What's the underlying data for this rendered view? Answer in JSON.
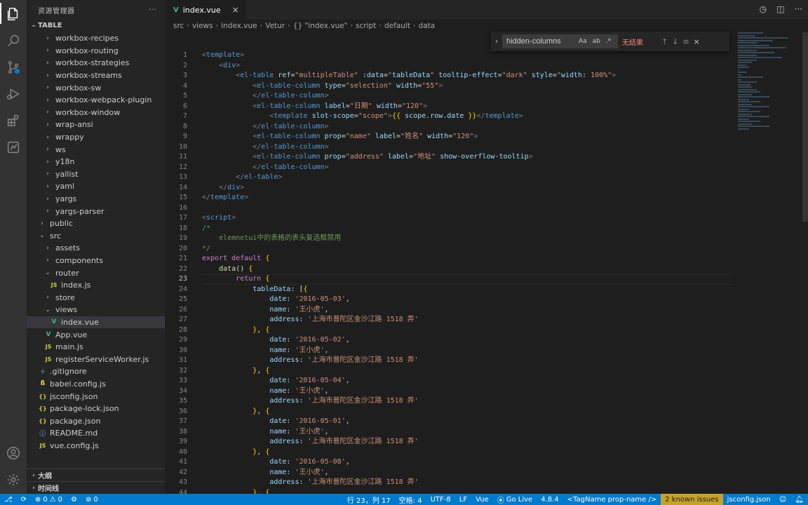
{
  "sidebar": {
    "title": "资源管理器",
    "more": "···",
    "section": "TABLE",
    "items": [
      {
        "label": "workbox-recipes",
        "depth": 2,
        "kind": "folder"
      },
      {
        "label": "workbox-routing",
        "depth": 2,
        "kind": "folder"
      },
      {
        "label": "workbox-strategies",
        "depth": 2,
        "kind": "folder"
      },
      {
        "label": "workbox-streams",
        "depth": 2,
        "kind": "folder"
      },
      {
        "label": "workbox-sw",
        "depth": 2,
        "kind": "folder"
      },
      {
        "label": "workbox-webpack-plugin",
        "depth": 2,
        "kind": "folder"
      },
      {
        "label": "workbox-window",
        "depth": 2,
        "kind": "folder"
      },
      {
        "label": "wrap-ansi",
        "depth": 2,
        "kind": "folder"
      },
      {
        "label": "wrappy",
        "depth": 2,
        "kind": "folder"
      },
      {
        "label": "ws",
        "depth": 2,
        "kind": "folder"
      },
      {
        "label": "y18n",
        "depth": 2,
        "kind": "folder"
      },
      {
        "label": "yallist",
        "depth": 2,
        "kind": "folder"
      },
      {
        "label": "yaml",
        "depth": 2,
        "kind": "folder"
      },
      {
        "label": "yargs",
        "depth": 2,
        "kind": "folder"
      },
      {
        "label": "yargs-parser",
        "depth": 2,
        "kind": "folder"
      },
      {
        "label": "public",
        "depth": 1,
        "kind": "folder"
      },
      {
        "label": "src",
        "depth": 1,
        "kind": "folder-open"
      },
      {
        "label": "assets",
        "depth": 2,
        "kind": "folder"
      },
      {
        "label": "components",
        "depth": 2,
        "kind": "folder"
      },
      {
        "label": "router",
        "depth": 2,
        "kind": "folder-open"
      },
      {
        "label": "index.js",
        "depth": 3,
        "kind": "js"
      },
      {
        "label": "store",
        "depth": 2,
        "kind": "folder"
      },
      {
        "label": "views",
        "depth": 2,
        "kind": "folder-open"
      },
      {
        "label": "index.vue",
        "depth": 3,
        "kind": "vue",
        "selected": true
      },
      {
        "label": "App.vue",
        "depth": 2,
        "kind": "vue"
      },
      {
        "label": "main.js",
        "depth": 2,
        "kind": "js"
      },
      {
        "label": "registerServiceWorker.js",
        "depth": 2,
        "kind": "js"
      },
      {
        "label": ".gitignore",
        "depth": 1,
        "kind": "git"
      },
      {
        "label": "babel.config.js",
        "depth": 1,
        "kind": "babel"
      },
      {
        "label": "jsconfig.json",
        "depth": 1,
        "kind": "json"
      },
      {
        "label": "package-lock.json",
        "depth": 1,
        "kind": "json"
      },
      {
        "label": "package.json",
        "depth": 1,
        "kind": "json"
      },
      {
        "label": "README.md",
        "depth": 1,
        "kind": "info"
      },
      {
        "label": "vue.config.js",
        "depth": 1,
        "kind": "js"
      }
    ],
    "outline": "大纲",
    "timeline": "时间线"
  },
  "icons": {
    "kind_glyphs": {
      "folder": "›",
      "folder-open": "⌄",
      "js": "JS",
      "vue": "V",
      "json": "{}",
      "info": "ⓘ",
      "babel": "ß",
      "git": "◆"
    }
  },
  "tab": {
    "label": "index.vue",
    "close": "×",
    "badge": "V"
  },
  "breadcrumb": [
    "src",
    "views",
    "index.vue",
    "Vetur",
    "{} \"index.vue\"",
    "script",
    "default",
    "data"
  ],
  "find": {
    "value": "hidden-columns",
    "placeholder": "查找",
    "match_case": "Aa",
    "whole_word": "ab",
    "regex": ".*",
    "result": "无结果"
  },
  "code": {
    "current_line": 23,
    "lines": [
      [
        [
          "t-br",
          "<"
        ],
        [
          "t-tag",
          "template"
        ],
        [
          "t-br",
          ">"
        ]
      ],
      [
        [
          "t-txt",
          "    "
        ],
        [
          "t-br",
          "<"
        ],
        [
          "t-tag",
          "div"
        ],
        [
          "t-br",
          ">"
        ]
      ],
      [
        [
          "t-txt",
          "        "
        ],
        [
          "t-br",
          "<"
        ],
        [
          "t-tag",
          "el-table"
        ],
        [
          "t-txt",
          " "
        ],
        [
          "t-attr",
          "ref"
        ],
        [
          "t-txt",
          "="
        ],
        [
          "t-str",
          "\"multipleTable\""
        ],
        [
          "t-txt",
          " "
        ],
        [
          "t-attr",
          ":data"
        ],
        [
          "t-txt",
          "="
        ],
        [
          "t-str",
          "\""
        ],
        [
          "t-prop",
          "tableData"
        ],
        [
          "t-str",
          "\""
        ],
        [
          "t-txt",
          " "
        ],
        [
          "t-attr",
          "tooltip-effect"
        ],
        [
          "t-txt",
          "="
        ],
        [
          "t-str",
          "\"dark\""
        ],
        [
          "t-txt",
          " "
        ],
        [
          "t-attr",
          "style"
        ],
        [
          "t-txt",
          "="
        ],
        [
          "t-str",
          "\""
        ],
        [
          "t-prop",
          "width"
        ],
        [
          "t-txt",
          ": "
        ],
        [
          "t-str",
          "100%\""
        ],
        [
          "t-br",
          ">"
        ]
      ],
      [
        [
          "t-txt",
          "            "
        ],
        [
          "t-br",
          "<"
        ],
        [
          "t-tag",
          "el-table-column"
        ],
        [
          "t-txt",
          " "
        ],
        [
          "t-attr",
          "type"
        ],
        [
          "t-txt",
          "="
        ],
        [
          "t-str",
          "\"selection\""
        ],
        [
          "t-txt",
          " "
        ],
        [
          "t-attr",
          "width"
        ],
        [
          "t-txt",
          "="
        ],
        [
          "t-str",
          "\"55\""
        ],
        [
          "t-br",
          ">"
        ]
      ],
      [
        [
          "t-txt",
          "            "
        ],
        [
          "t-br",
          "</"
        ],
        [
          "t-tag",
          "el-table-column"
        ],
        [
          "t-br",
          ">"
        ]
      ],
      [
        [
          "t-txt",
          "            "
        ],
        [
          "t-br",
          "<"
        ],
        [
          "t-tag",
          "el-table-column"
        ],
        [
          "t-txt",
          " "
        ],
        [
          "t-attr",
          "label"
        ],
        [
          "t-txt",
          "="
        ],
        [
          "t-str",
          "\"日期\""
        ],
        [
          "t-txt",
          " "
        ],
        [
          "t-attr",
          "width"
        ],
        [
          "t-txt",
          "="
        ],
        [
          "t-str",
          "\"120\""
        ],
        [
          "t-br",
          ">"
        ]
      ],
      [
        [
          "t-txt",
          "                "
        ],
        [
          "t-br",
          "<"
        ],
        [
          "t-tag",
          "template"
        ],
        [
          "t-txt",
          " "
        ],
        [
          "t-attr",
          "slot-scope"
        ],
        [
          "t-txt",
          "="
        ],
        [
          "t-str",
          "\"scope\""
        ],
        [
          "t-br",
          ">"
        ],
        [
          "t-yel",
          "{{"
        ],
        [
          "t-txt",
          " "
        ],
        [
          "t-prop",
          "scope.row.date"
        ],
        [
          "t-txt",
          " "
        ],
        [
          "t-yel",
          "}}"
        ],
        [
          "t-br",
          "</"
        ],
        [
          "t-tag",
          "template"
        ],
        [
          "t-br",
          ">"
        ]
      ],
      [
        [
          "t-txt",
          "            "
        ],
        [
          "t-br",
          "</"
        ],
        [
          "t-tag",
          "el-table-column"
        ],
        [
          "t-br",
          ">"
        ]
      ],
      [
        [
          "t-txt",
          "            "
        ],
        [
          "t-br",
          "<"
        ],
        [
          "t-tag",
          "el-table-column"
        ],
        [
          "t-txt",
          " "
        ],
        [
          "t-attr",
          "prop"
        ],
        [
          "t-txt",
          "="
        ],
        [
          "t-str",
          "\"name\""
        ],
        [
          "t-txt",
          " "
        ],
        [
          "t-attr",
          "label"
        ],
        [
          "t-txt",
          "="
        ],
        [
          "t-str",
          "\"姓名\""
        ],
        [
          "t-txt",
          " "
        ],
        [
          "t-attr",
          "width"
        ],
        [
          "t-txt",
          "="
        ],
        [
          "t-str",
          "\"120\""
        ],
        [
          "t-br",
          ">"
        ]
      ],
      [
        [
          "t-txt",
          "            "
        ],
        [
          "t-br",
          "</"
        ],
        [
          "t-tag",
          "el-table-column"
        ],
        [
          "t-br",
          ">"
        ]
      ],
      [
        [
          "t-txt",
          "            "
        ],
        [
          "t-br",
          "<"
        ],
        [
          "t-tag",
          "el-table-column"
        ],
        [
          "t-txt",
          " "
        ],
        [
          "t-attr",
          "prop"
        ],
        [
          "t-txt",
          "="
        ],
        [
          "t-str",
          "\"address\""
        ],
        [
          "t-txt",
          " "
        ],
        [
          "t-attr",
          "label"
        ],
        [
          "t-txt",
          "="
        ],
        [
          "t-str",
          "\"地址\""
        ],
        [
          "t-txt",
          " "
        ],
        [
          "t-attr",
          "show-overflow-tooltip"
        ],
        [
          "t-br",
          ">"
        ]
      ],
      [
        [
          "t-txt",
          "            "
        ],
        [
          "t-br",
          "</"
        ],
        [
          "t-tag",
          "el-table-column"
        ],
        [
          "t-br",
          ">"
        ]
      ],
      [
        [
          "t-txt",
          "        "
        ],
        [
          "t-br",
          "</"
        ],
        [
          "t-tag",
          "el-table"
        ],
        [
          "t-br",
          ">"
        ]
      ],
      [
        [
          "t-txt",
          "    "
        ],
        [
          "t-br",
          "</"
        ],
        [
          "t-tag",
          "div"
        ],
        [
          "t-br",
          ">"
        ]
      ],
      [
        [
          "t-br",
          "</"
        ],
        [
          "t-tag",
          "template"
        ],
        [
          "t-br",
          ">"
        ]
      ],
      [],
      [
        [
          "t-br",
          "<"
        ],
        [
          "t-tag",
          "script"
        ],
        [
          "t-br",
          ">"
        ]
      ],
      [
        [
          "t-com",
          "/*"
        ]
      ],
      [
        [
          "t-com",
          "    elemnetui中的表格的表头复选框禁用"
        ]
      ],
      [
        [
          "t-com",
          "*/"
        ]
      ],
      [
        [
          "t-ctl",
          "export"
        ],
        [
          "t-txt",
          " "
        ],
        [
          "t-ctl",
          "default"
        ],
        [
          "t-txt",
          " "
        ],
        [
          "t-yel",
          "{"
        ]
      ],
      [
        [
          "t-txt",
          "    "
        ],
        [
          "t-fn",
          "data"
        ],
        [
          "t-txt",
          "() "
        ],
        [
          "t-yel",
          "{"
        ]
      ],
      [
        [
          "t-txt",
          "        "
        ],
        [
          "t-ctl",
          "return"
        ],
        [
          "t-txt",
          " "
        ],
        [
          "t-yel",
          "{"
        ]
      ],
      [
        [
          "t-txt",
          "            "
        ],
        [
          "t-prop",
          "tableData"
        ],
        [
          "t-txt",
          ": ["
        ],
        [
          "t-yel",
          "{"
        ]
      ],
      [
        [
          "t-txt",
          "                "
        ],
        [
          "t-prop",
          "date"
        ],
        [
          "t-txt",
          ": "
        ],
        [
          "t-str",
          "'2016-05-03'"
        ],
        [
          "t-txt",
          ","
        ]
      ],
      [
        [
          "t-txt",
          "                "
        ],
        [
          "t-prop",
          "name"
        ],
        [
          "t-txt",
          ": "
        ],
        [
          "t-str",
          "'王小虎'"
        ],
        [
          "t-txt",
          ","
        ]
      ],
      [
        [
          "t-txt",
          "                "
        ],
        [
          "t-prop",
          "address"
        ],
        [
          "t-txt",
          ": "
        ],
        [
          "t-str",
          "'上海市普陀区金沙江路 1518 弄'"
        ]
      ],
      [
        [
          "t-txt",
          "            "
        ],
        [
          "t-yel",
          "}"
        ],
        [
          "t-txt",
          ", "
        ],
        [
          "t-yel",
          "{"
        ]
      ],
      [
        [
          "t-txt",
          "                "
        ],
        [
          "t-prop",
          "date"
        ],
        [
          "t-txt",
          ": "
        ],
        [
          "t-str",
          "'2016-05-02'"
        ],
        [
          "t-txt",
          ","
        ]
      ],
      [
        [
          "t-txt",
          "                "
        ],
        [
          "t-prop",
          "name"
        ],
        [
          "t-txt",
          ": "
        ],
        [
          "t-str",
          "'王小虎'"
        ],
        [
          "t-txt",
          ","
        ]
      ],
      [
        [
          "t-txt",
          "                "
        ],
        [
          "t-prop",
          "address"
        ],
        [
          "t-txt",
          ": "
        ],
        [
          "t-str",
          "'上海市普陀区金沙江路 1518 弄'"
        ]
      ],
      [
        [
          "t-txt",
          "            "
        ],
        [
          "t-yel",
          "}"
        ],
        [
          "t-txt",
          ", "
        ],
        [
          "t-yel",
          "{"
        ]
      ],
      [
        [
          "t-txt",
          "                "
        ],
        [
          "t-prop",
          "date"
        ],
        [
          "t-txt",
          ": "
        ],
        [
          "t-str",
          "'2016-05-04'"
        ],
        [
          "t-txt",
          ","
        ]
      ],
      [
        [
          "t-txt",
          "                "
        ],
        [
          "t-prop",
          "name"
        ],
        [
          "t-txt",
          ": "
        ],
        [
          "t-str",
          "'王小虎'"
        ],
        [
          "t-txt",
          ","
        ]
      ],
      [
        [
          "t-txt",
          "                "
        ],
        [
          "t-prop",
          "address"
        ],
        [
          "t-txt",
          ": "
        ],
        [
          "t-str",
          "'上海市普陀区金沙江路 1518 弄'"
        ]
      ],
      [
        [
          "t-txt",
          "            "
        ],
        [
          "t-yel",
          "}"
        ],
        [
          "t-txt",
          ", "
        ],
        [
          "t-yel",
          "{"
        ]
      ],
      [
        [
          "t-txt",
          "                "
        ],
        [
          "t-prop",
          "date"
        ],
        [
          "t-txt",
          ": "
        ],
        [
          "t-str",
          "'2016-05-01'"
        ],
        [
          "t-txt",
          ","
        ]
      ],
      [
        [
          "t-txt",
          "                "
        ],
        [
          "t-prop",
          "name"
        ],
        [
          "t-txt",
          ": "
        ],
        [
          "t-str",
          "'王小虎'"
        ],
        [
          "t-txt",
          ","
        ]
      ],
      [
        [
          "t-txt",
          "                "
        ],
        [
          "t-prop",
          "address"
        ],
        [
          "t-txt",
          ": "
        ],
        [
          "t-str",
          "'上海市普陀区金沙江路 1518 弄'"
        ]
      ],
      [
        [
          "t-txt",
          "            "
        ],
        [
          "t-yel",
          "}"
        ],
        [
          "t-txt",
          ", "
        ],
        [
          "t-yel",
          "{"
        ]
      ],
      [
        [
          "t-txt",
          "                "
        ],
        [
          "t-prop",
          "date"
        ],
        [
          "t-txt",
          ": "
        ],
        [
          "t-str",
          "'2016-05-08'"
        ],
        [
          "t-txt",
          ","
        ]
      ],
      [
        [
          "t-txt",
          "                "
        ],
        [
          "t-prop",
          "name"
        ],
        [
          "t-txt",
          ": "
        ],
        [
          "t-str",
          "'王小虎'"
        ],
        [
          "t-txt",
          ","
        ]
      ],
      [
        [
          "t-txt",
          "                "
        ],
        [
          "t-prop",
          "address"
        ],
        [
          "t-txt",
          ": "
        ],
        [
          "t-str",
          "'上海市普陀区金沙江路 1518 弄'"
        ]
      ],
      [
        [
          "t-txt",
          "            "
        ],
        [
          "t-yel",
          "}"
        ],
        [
          "t-txt",
          ", "
        ],
        [
          "t-yel",
          "{"
        ]
      ]
    ]
  },
  "status": {
    "branch_icon": "⎇",
    "errors": "0",
    "warnings": "0",
    "ports": "0",
    "position": "行 23，列 17",
    "spaces": "空格: 4",
    "encoding": "UTF-8",
    "eol": "LF",
    "language": "Vue",
    "golive": "Go Live",
    "version": "4.8.4",
    "tagname": "<TagName prop-name />",
    "issues": "2 known issues",
    "config": "jsconfig.json"
  }
}
